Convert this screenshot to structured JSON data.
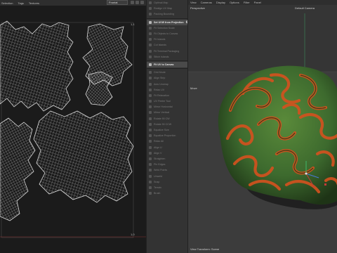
{
  "uv_editor": {
    "menu": [
      "Selection",
      "Tags",
      "Textures"
    ],
    "projection_dropdown": "Frontal",
    "corner_top": "1,1",
    "corner_bottom": "1,0"
  },
  "tools_panel": {
    "items": [
      {
        "label": "Optimal Map",
        "active": false
      },
      {
        "label": "Realign UV Map",
        "active": false
      },
      {
        "label": "Packing Bounding",
        "active": false
      },
      {
        "label": "Set UVW from Projection",
        "active": true,
        "has_gear": true
      },
      {
        "label": "Fit Selection Scale",
        "active": false
      },
      {
        "label": "Fit Objects to Canvas",
        "active": false
      },
      {
        "label": "Fit Islands",
        "active": false
      },
      {
        "label": "Cut Islands",
        "active": false
      },
      {
        "label": "Fit Terminal Packaging",
        "active": false
      },
      {
        "label": "Stitch Islands",
        "active": false
      },
      {
        "label": "Fit UV to Canvas",
        "active": true
      },
      {
        "label": "Grid Mode",
        "active": false
      },
      {
        "label": "Align Strip",
        "active": false
      },
      {
        "label": "Auto Unwrap",
        "active": false
      },
      {
        "label": "Relax UV",
        "active": false
      },
      {
        "label": "Fit Relaxation",
        "active": false
      },
      {
        "label": "UV Peeler Tool",
        "active": false
      },
      {
        "label": "Mirror Horizontal",
        "active": false
      },
      {
        "label": "Mirror Vertical",
        "active": false
      },
      {
        "label": "Rotate 90 CW",
        "active": false
      },
      {
        "label": "Rotate 90 CCW",
        "active": false
      },
      {
        "label": "Equalize Size",
        "active": false
      },
      {
        "label": "Equalize Proportion",
        "active": false
      },
      {
        "label": "Relax All",
        "active": false
      },
      {
        "label": "Align U",
        "active": false
      },
      {
        "label": "Align V",
        "active": false
      },
      {
        "label": "Straighten",
        "active": false
      },
      {
        "label": "Pin Edges",
        "active": false
      },
      {
        "label": "Weld Points",
        "active": false
      },
      {
        "label": "Unweld",
        "active": false
      },
      {
        "label": "Snap",
        "active": false
      },
      {
        "label": "Terrain",
        "active": false
      },
      {
        "label": "Brush",
        "active": false
      }
    ]
  },
  "viewport": {
    "menu": [
      "View",
      "Cameras",
      "Display",
      "Options",
      "Filter",
      "Panel"
    ],
    "view_name": "Perspective",
    "camera_name": "Default Camera",
    "move_label": "Move",
    "status": "View Transform: Scene"
  },
  "colors": {
    "uv_background": "#1b1b1b",
    "uv_wire": "#cfcfcf",
    "viewport_background": "#3a3a3a",
    "brain_green": "#3d6a2e",
    "brain_orange": "#d2521f",
    "axis_red": "#c43a3a",
    "axis_green": "#41b76a",
    "axis_blue": "#4a78d8"
  }
}
